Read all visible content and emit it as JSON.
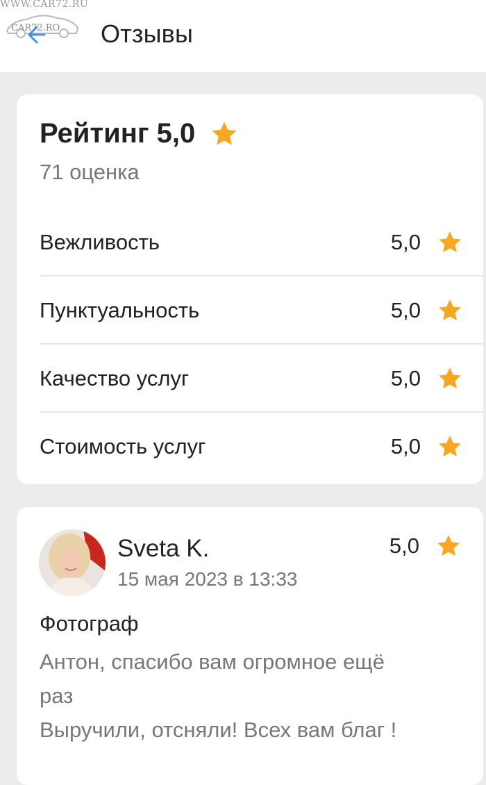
{
  "watermark": {
    "text": "WWW.CAR72.RU",
    "logo_text": "CAR72.RO"
  },
  "header": {
    "title": "Отзывы",
    "back_icon": "arrow-left-icon"
  },
  "colors": {
    "star": "#f6a723",
    "accent_back": "#4a90e2"
  },
  "rating": {
    "title": "Рейтинг 5,0",
    "count": "71 оценка",
    "criteria": [
      {
        "label": "Вежливость",
        "value": "5,0"
      },
      {
        "label": "Пунктуальность",
        "value": "5,0"
      },
      {
        "label": "Качество услуг",
        "value": "5,0"
      },
      {
        "label": "Стоимость услуг",
        "value": "5,0"
      }
    ]
  },
  "review": {
    "name": "Sveta K.",
    "date": "15 мая 2023 в 13:33",
    "score": "5,0",
    "category": "Фотограф",
    "text": "Антон, спасибо вам огромное ещё\nраз\nВыручили, отсняли! Всех вам благ !"
  }
}
